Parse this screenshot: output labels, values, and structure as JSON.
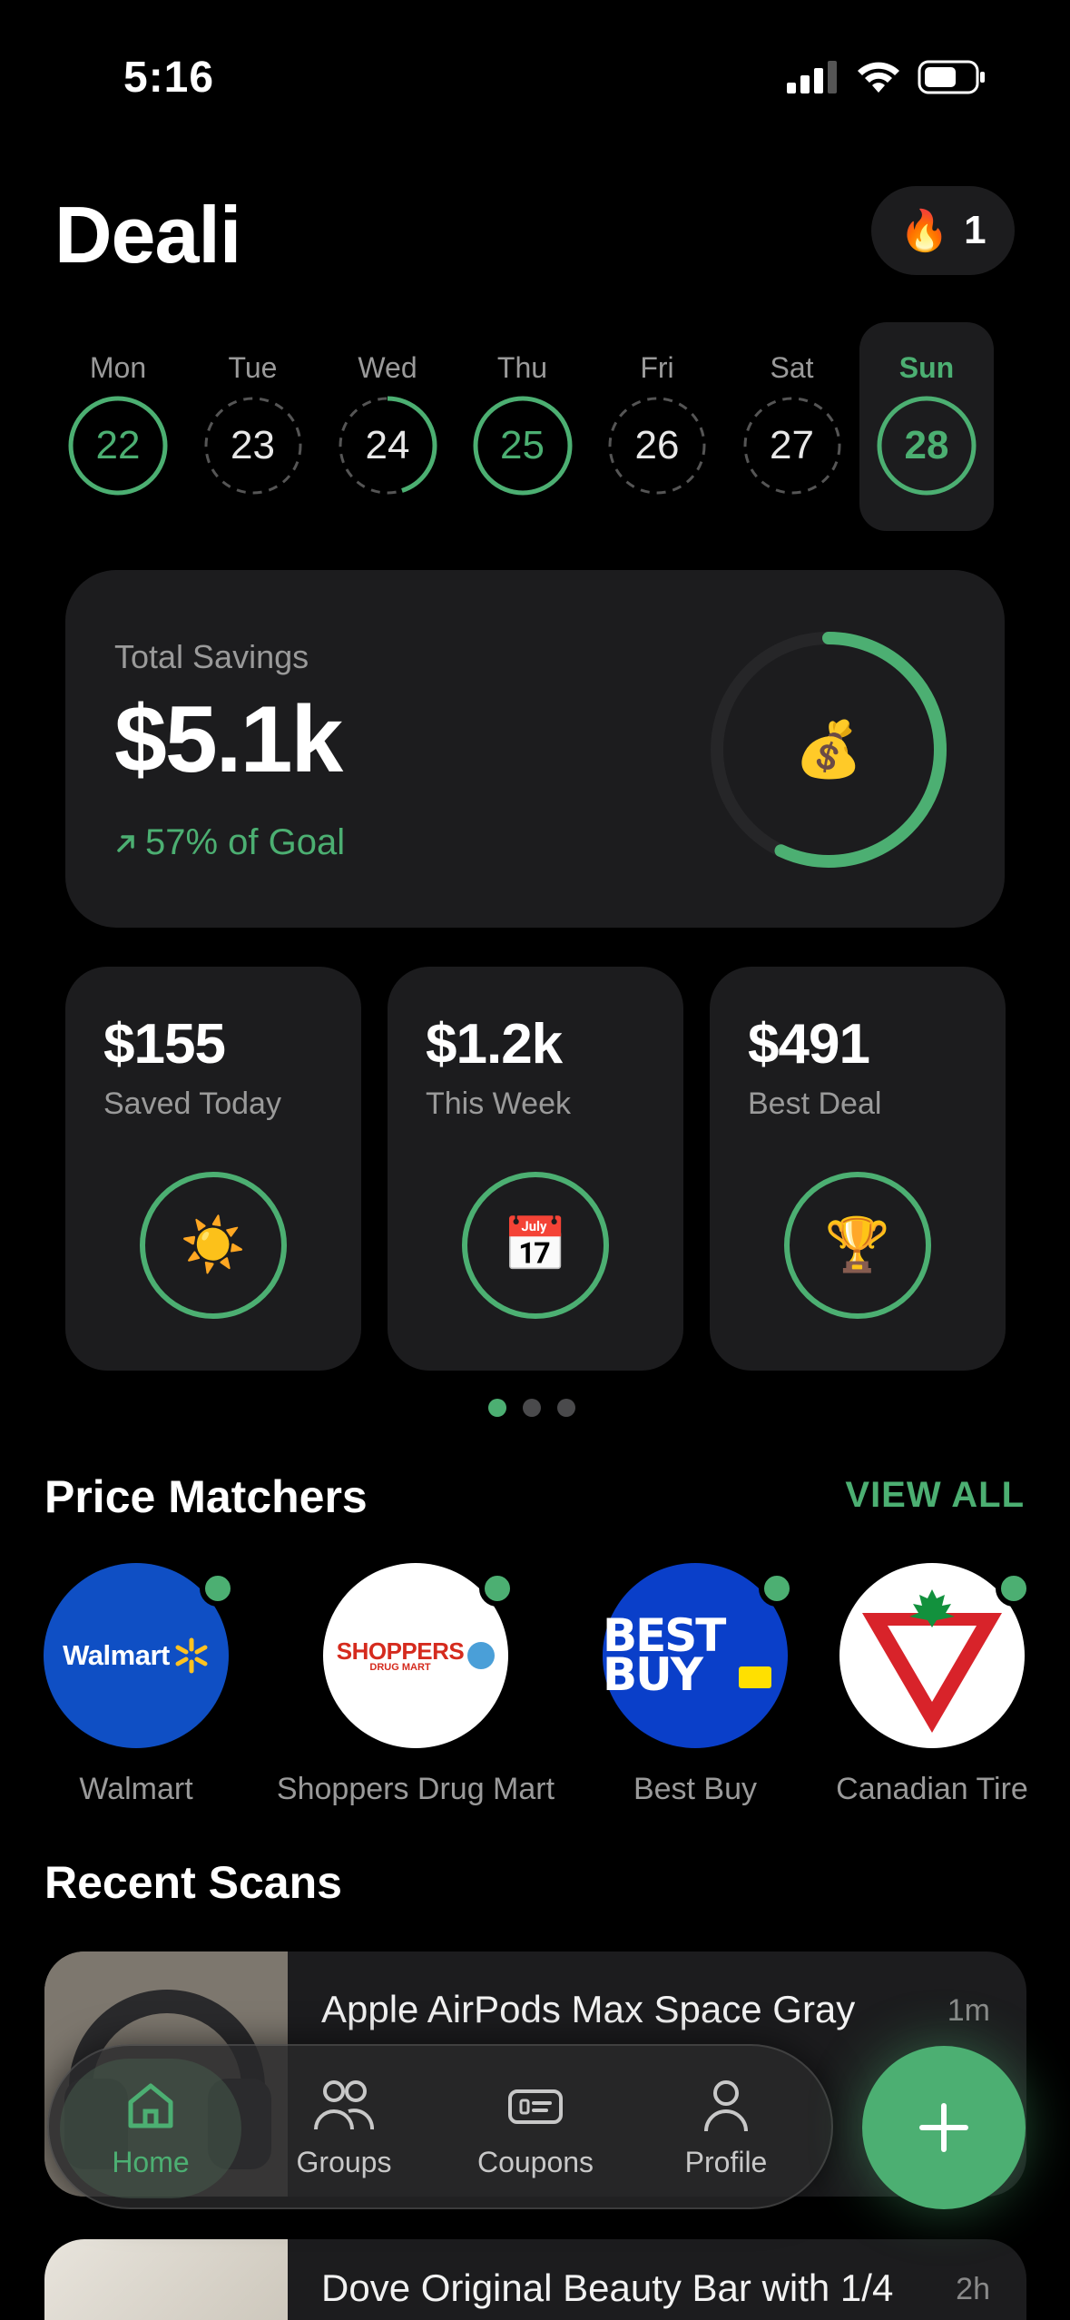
{
  "status_bar": {
    "time": "5:16"
  },
  "header": {
    "title": "Deali",
    "streak_icon": "fire-icon",
    "streak_count": "1"
  },
  "week": [
    {
      "name": "Mon",
      "date": "22",
      "progress": 1.0,
      "state": "done"
    },
    {
      "name": "Tue",
      "date": "23",
      "progress": 0.0,
      "state": "empty"
    },
    {
      "name": "Wed",
      "date": "24",
      "progress": 0.45,
      "state": "partial"
    },
    {
      "name": "Thu",
      "date": "25",
      "progress": 1.0,
      "state": "done"
    },
    {
      "name": "Fri",
      "date": "26",
      "progress": 0.0,
      "state": "empty"
    },
    {
      "name": "Sat",
      "date": "27",
      "progress": 0.0,
      "state": "empty"
    },
    {
      "name": "Sun",
      "date": "28",
      "progress": 1.0,
      "state": "today"
    }
  ],
  "savings": {
    "label": "Total Savings",
    "amount": "$5.1k",
    "goal_text": "57% of Goal",
    "goal_progress": 0.57,
    "icon": "money-bag-icon"
  },
  "stats": [
    {
      "value": "$155",
      "caption": "Saved Today",
      "icon": "sun-icon",
      "emoji": "☀️"
    },
    {
      "value": "$1.2k",
      "caption": "This Week",
      "icon": "calendar-icon",
      "emoji": "📅"
    },
    {
      "value": "$491",
      "caption": "Best Deal",
      "icon": "trophy-icon",
      "emoji": "🏆"
    }
  ],
  "pager": {
    "pages": 3,
    "active": 0
  },
  "price_matchers": {
    "title": "Price Matchers",
    "view_all": "VIEW ALL",
    "stores": [
      {
        "name": "Walmart",
        "logo_text": "Walmart",
        "color": "#0f4fc4"
      },
      {
        "name": "Shoppers Drug Mart",
        "logo_text": "SHOPPERS",
        "logo_sub": "DRUG MART",
        "color": "#ffffff"
      },
      {
        "name": "Best Buy",
        "logo_text": "BEST BUY",
        "color": "#0a3fc9"
      },
      {
        "name": "Canadian Tire",
        "logo_text": "",
        "color": "#ffffff"
      }
    ]
  },
  "recent_scans": {
    "title": "Recent Scans",
    "items": [
      {
        "title": "Apple AirPods Max Space Gray",
        "ago": "1m"
      },
      {
        "title": "Dove Original Beauty Bar with 1/4",
        "ago": "2h"
      }
    ]
  },
  "nav": {
    "items": [
      {
        "label": "Home",
        "icon": "home-icon",
        "active": true
      },
      {
        "label": "Groups",
        "icon": "groups-icon",
        "active": false
      },
      {
        "label": "Coupons",
        "icon": "coupon-icon",
        "active": false
      },
      {
        "label": "Profile",
        "icon": "profile-icon",
        "active": false
      }
    ],
    "fab_icon": "plus-icon"
  },
  "colors": {
    "accent": "#4caf72",
    "card": "#1c1c1e",
    "background": "#000000"
  }
}
